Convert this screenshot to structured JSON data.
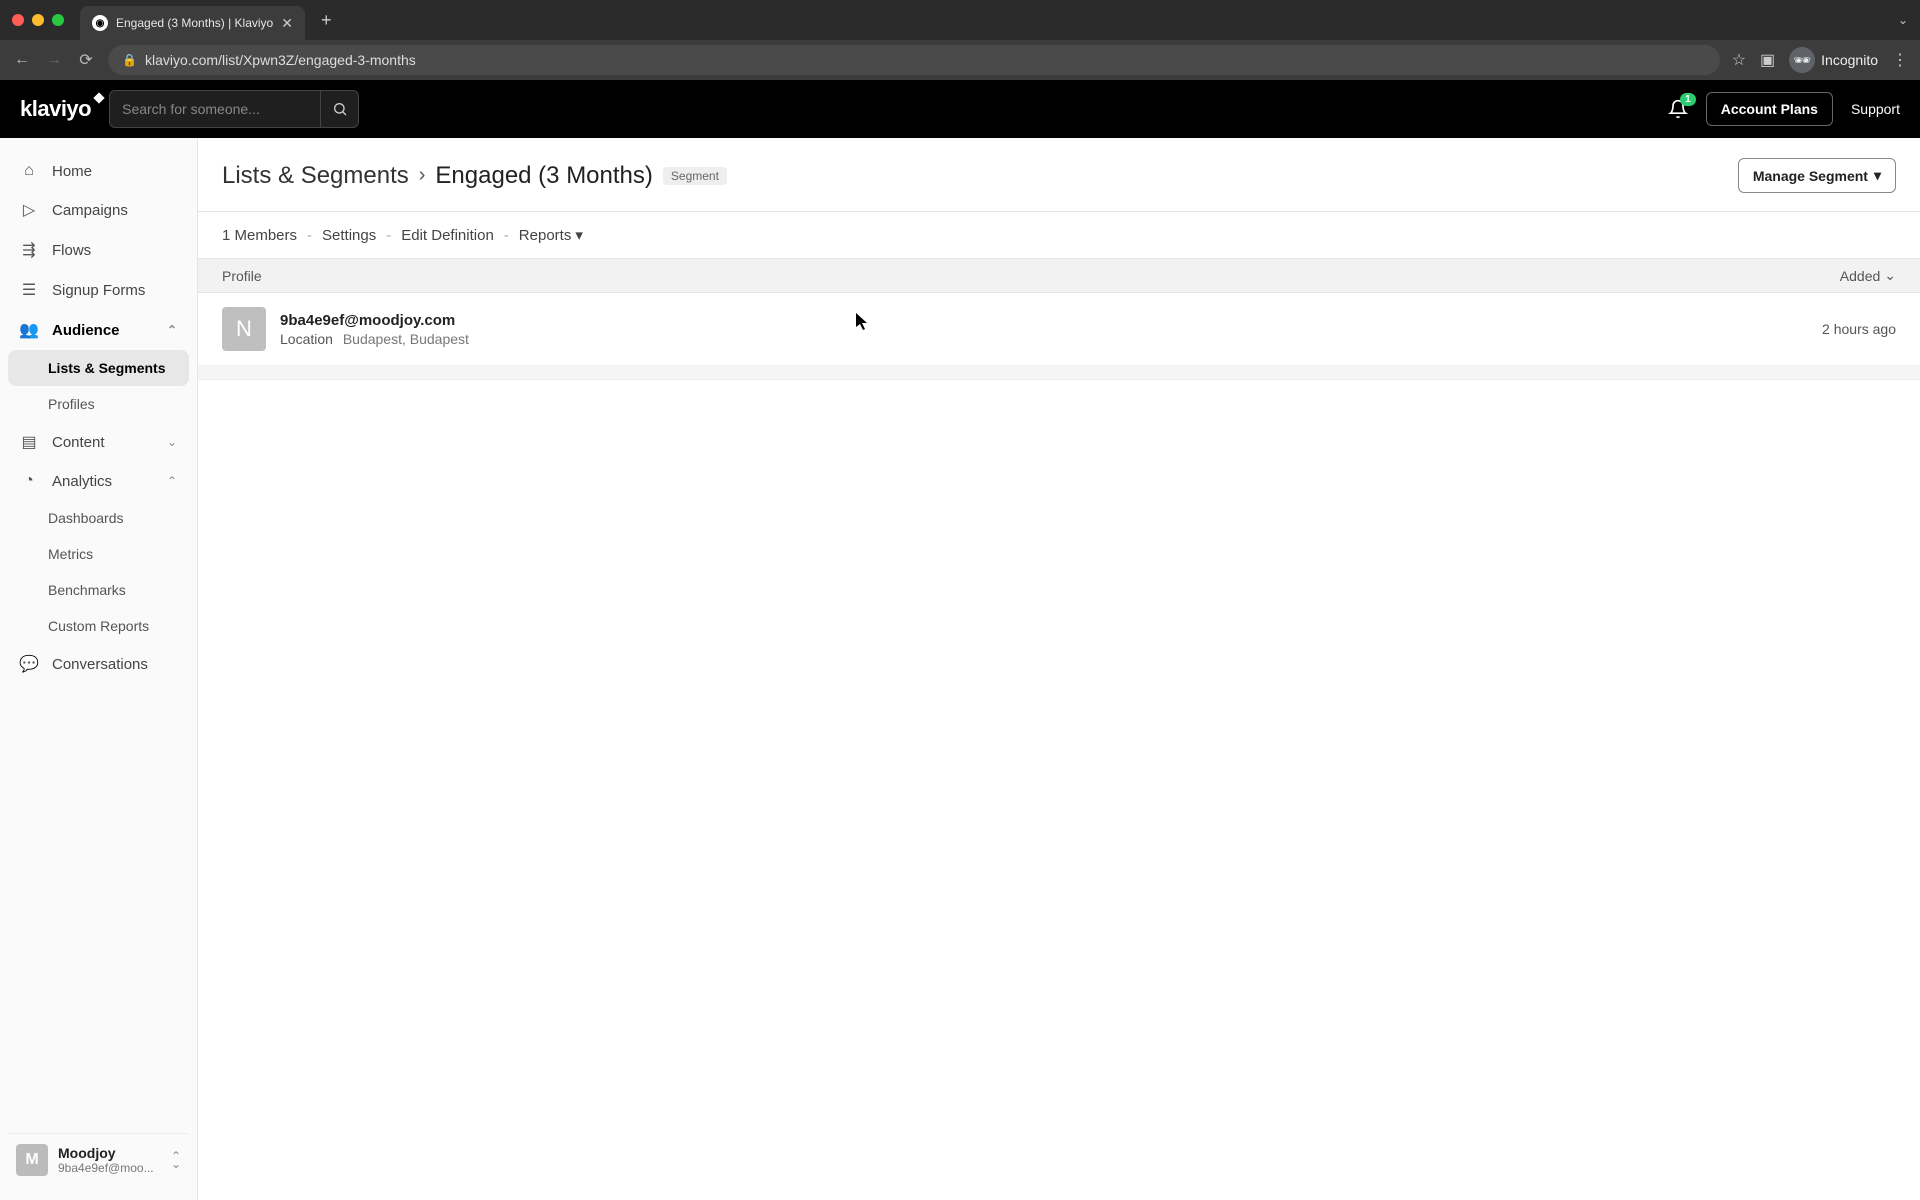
{
  "browser": {
    "tab_title": "Engaged (3 Months) | Klaviyo",
    "url": "klaviyo.com/list/Xpwn3Z/engaged-3-months",
    "incognito_label": "Incognito"
  },
  "topbar": {
    "logo_text": "klaviyo",
    "search_placeholder": "Search for someone...",
    "notification_count": "1",
    "account_plans": "Account Plans",
    "support": "Support"
  },
  "sidebar": {
    "items": {
      "home": "Home",
      "campaigns": "Campaigns",
      "flows": "Flows",
      "signup_forms": "Signup Forms",
      "audience": "Audience",
      "lists_segments": "Lists & Segments",
      "profiles": "Profiles",
      "content": "Content",
      "analytics": "Analytics",
      "dashboards": "Dashboards",
      "metrics": "Metrics",
      "benchmarks": "Benchmarks",
      "custom_reports": "Custom Reports",
      "conversations": "Conversations"
    },
    "footer": {
      "org_avatar_letter": "M",
      "org_name": "Moodjoy",
      "org_sub": "9ba4e9ef@moo..."
    }
  },
  "breadcrumb": {
    "root": "Lists & Segments",
    "current": "Engaged (3 Months)",
    "badge": "Segment",
    "manage_label": "Manage Segment"
  },
  "subnav": {
    "members": "1 Members",
    "settings": "Settings",
    "edit_def": "Edit Definition",
    "reports": "Reports"
  },
  "table": {
    "profile_header": "Profile",
    "added_header": "Added",
    "rows": [
      {
        "avatar_letter": "N",
        "email": "9ba4e9ef@moodjoy.com",
        "location_label": "Location",
        "location_value": "Budapest, Budapest",
        "added": "2 hours ago"
      }
    ]
  }
}
